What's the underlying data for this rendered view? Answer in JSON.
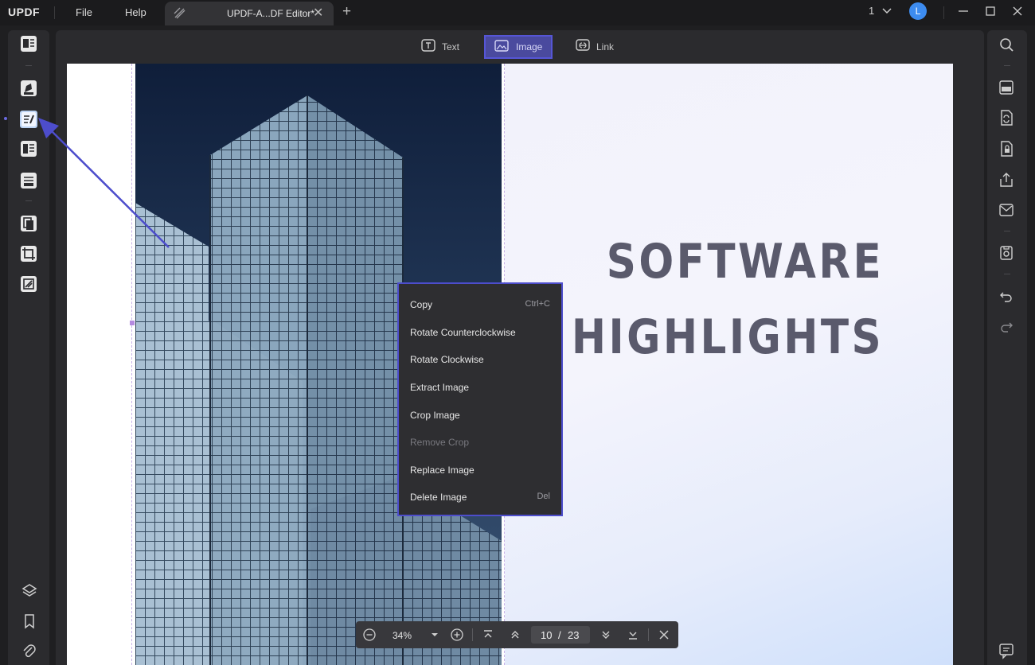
{
  "app": {
    "logo": "UPDF",
    "menu": [
      "File",
      "Help"
    ],
    "tab_title": "UPDF-A...DF Editor*",
    "tab_close": "✕",
    "new_tab": "+",
    "page_selector": "1",
    "avatar_initial": "L"
  },
  "toolbar": {
    "text_label": "Text",
    "image_label": "Image",
    "link_label": "Link"
  },
  "document": {
    "heading_line1": "SOFTWARE",
    "heading_line2": "HIGHLIGHTS"
  },
  "context_menu": {
    "items": [
      {
        "label": "Copy",
        "shortcut": "Ctrl+C",
        "enabled": true
      },
      {
        "label": "Rotate Counterclockwise",
        "shortcut": "",
        "enabled": true
      },
      {
        "label": "Rotate Clockwise",
        "shortcut": "",
        "enabled": true
      },
      {
        "label": "Extract Image",
        "shortcut": "",
        "enabled": true
      },
      {
        "label": "Crop Image",
        "shortcut": "",
        "enabled": true
      },
      {
        "label": "Remove Crop",
        "shortcut": "",
        "enabled": false
      },
      {
        "label": "Replace Image",
        "shortcut": "",
        "enabled": true
      },
      {
        "label": "Delete Image",
        "shortcut": "Del",
        "enabled": true
      }
    ]
  },
  "bottom_bar": {
    "zoom": "34%",
    "current_page": "10",
    "page_separator": "/",
    "total_pages": "23"
  },
  "colors": {
    "accent": "#5656d6",
    "avatar": "#3d8cf0",
    "heading": "#5a5a6c"
  },
  "icons": {
    "left_sidebar": [
      "reader-icon",
      "comment-icon",
      "edit-pdf-icon",
      "form-icon",
      "fill-sign-icon",
      "organize-pages-icon",
      "crop-pages-icon",
      "protect-icon",
      "layers-icon",
      "bookmark-icon",
      "attachment-icon"
    ],
    "right_sidebar": [
      "search-icon",
      "ocr-icon",
      "convert-icon",
      "protect-file-icon",
      "share-icon",
      "email-icon",
      "save-icon",
      "undo-icon",
      "redo-icon",
      "chat-icon"
    ]
  }
}
